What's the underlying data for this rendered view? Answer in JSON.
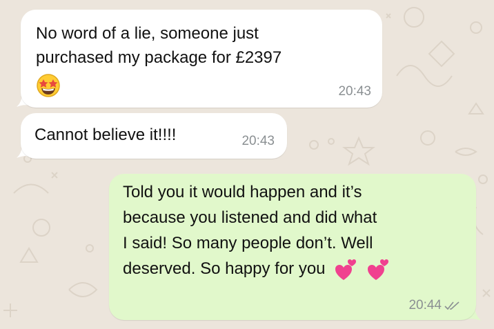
{
  "chat": {
    "messages": [
      {
        "direction": "incoming",
        "lines": [
          "No word of a lie, someone just",
          "purchased my package for £2397"
        ],
        "emoji": "star-struck-emoji",
        "time": "20:43"
      },
      {
        "direction": "incoming",
        "lines": [
          "Cannot believe it!!!!"
        ],
        "time": "20:43"
      },
      {
        "direction": "outgoing",
        "lines": [
          "Told you it would happen and it’s",
          "because you listened and did what",
          "I said! So many people don’t. Well",
          "deserved. So happy for you"
        ],
        "emoji": "two-hearts-emoji",
        "time": "20:44",
        "status": "read-ticks-icon"
      }
    ]
  },
  "colors": {
    "wallpaper": "#ece5dc",
    "incoming_bubble": "#ffffff",
    "outgoing_bubble": "#e1f8cb",
    "timestamp": "#8a8f92",
    "heart": "#f0418f"
  }
}
